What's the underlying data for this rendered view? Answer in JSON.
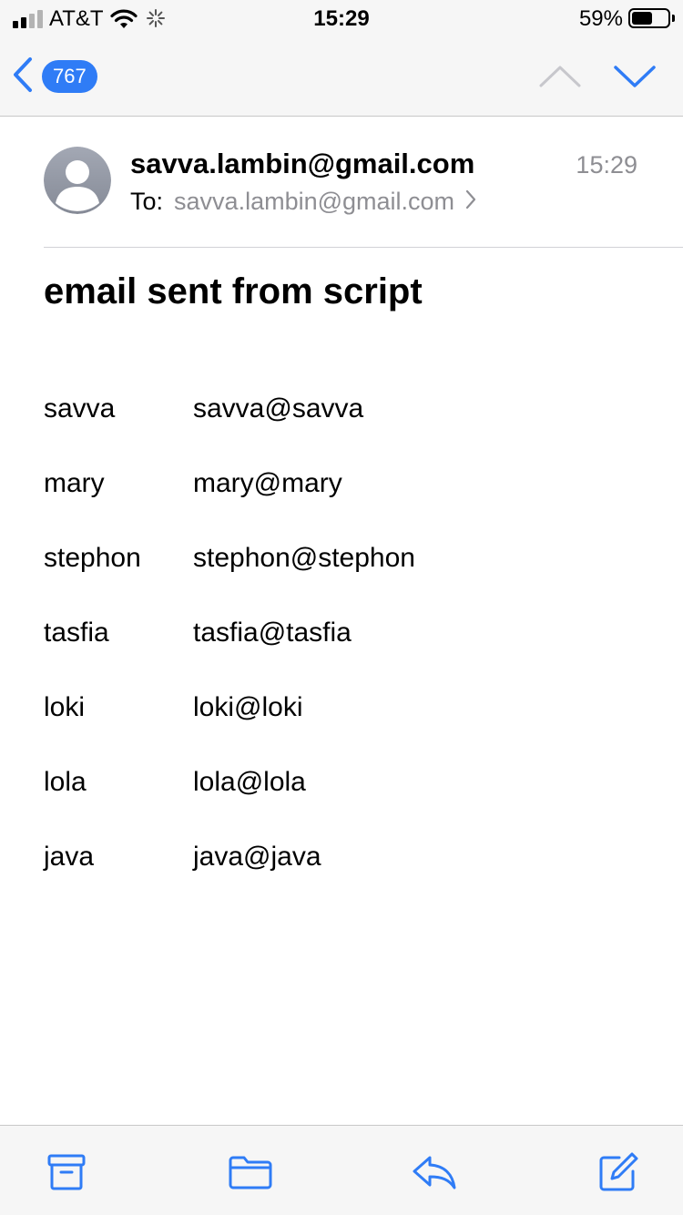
{
  "status_bar": {
    "carrier": "AT&T",
    "time": "15:29",
    "battery_percent": "59%",
    "battery_level": 0.59,
    "signal_bars_active": 2,
    "signal_bars_total": 4
  },
  "nav": {
    "unread_count": "767",
    "accent_color": "#2f7cf6"
  },
  "email": {
    "sender": "savva.lambin@gmail.com",
    "time": "15:29",
    "to_label": "To:",
    "to_value": "savva.lambin@gmail.com",
    "subject": "email sent from script",
    "rows": [
      {
        "name": "savva",
        "email": "savva@savva"
      },
      {
        "name": "mary",
        "email": "mary@mary"
      },
      {
        "name": "stephon",
        "email": "stephon@stephon"
      },
      {
        "name": "tasfia",
        "email": "tasfia@tasfia"
      },
      {
        "name": "loki",
        "email": "loki@loki"
      },
      {
        "name": "lola",
        "email": "lola@lola"
      },
      {
        "name": "java",
        "email": "java@java"
      }
    ]
  },
  "toolbar": {
    "icons": [
      "archive-icon",
      "folder-icon",
      "reply-icon",
      "compose-icon"
    ]
  }
}
